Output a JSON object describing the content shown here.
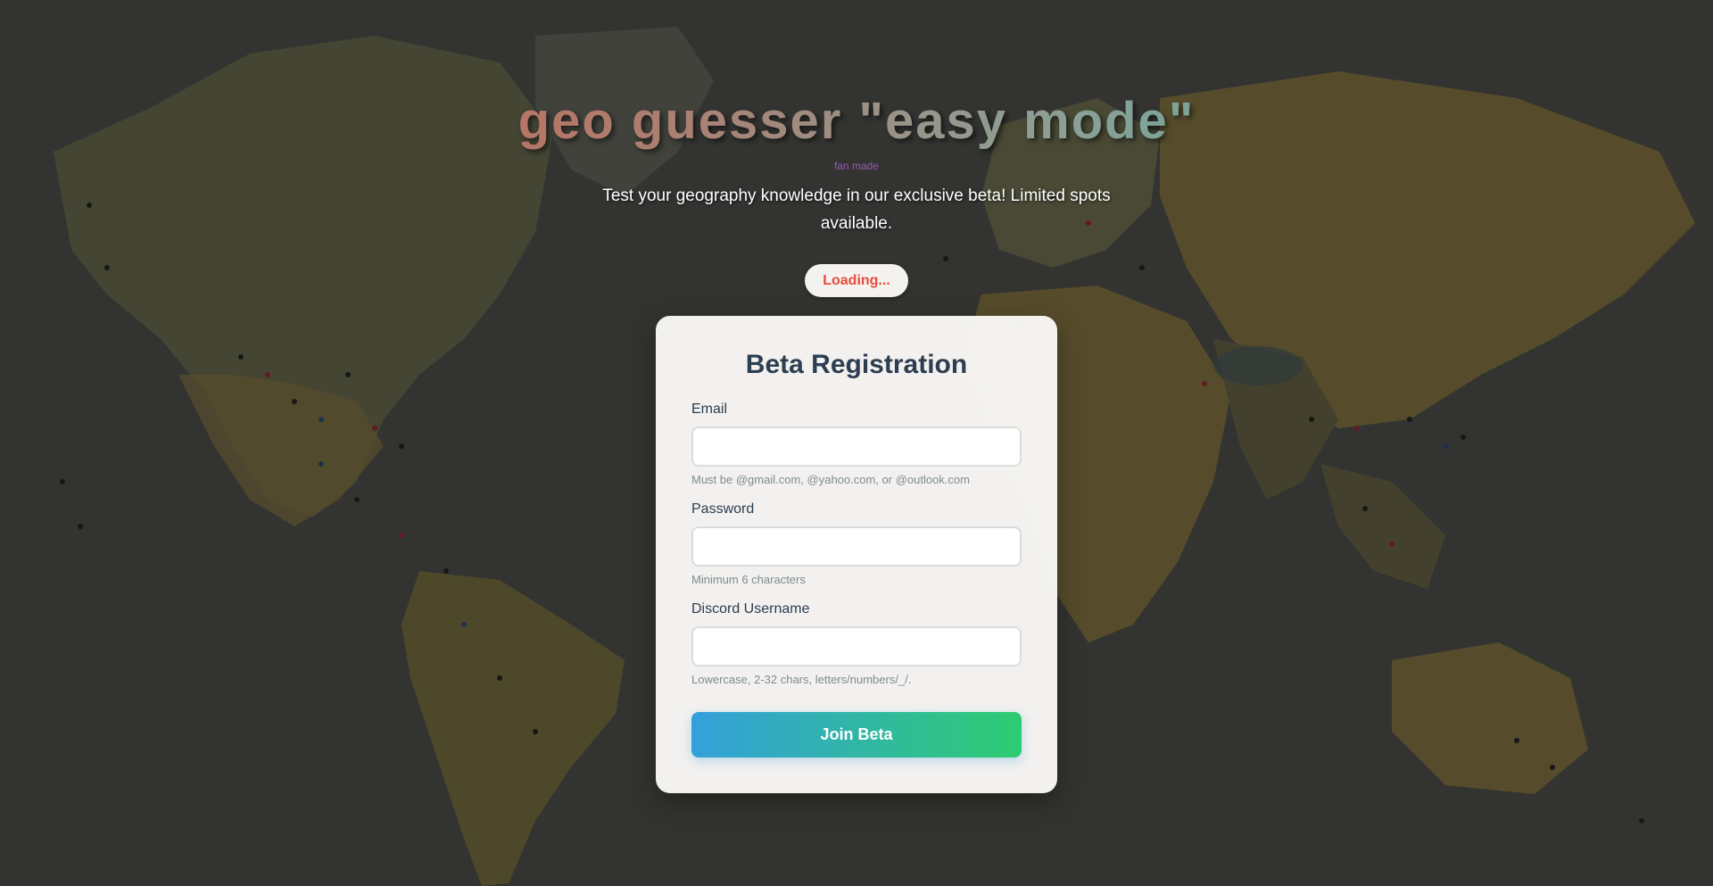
{
  "header": {
    "title": "geo guesser \"easy mode\"",
    "tagline": "fan made",
    "subtitle": "Test your geography knowledge in our exclusive beta! Limited spots available.",
    "status": "Loading..."
  },
  "form": {
    "title": "Beta Registration",
    "email": {
      "label": "Email",
      "value": "",
      "hint": "Must be @gmail.com, @yahoo.com, or @outlook.com"
    },
    "password": {
      "label": "Password",
      "value": "",
      "hint": "Minimum 6 characters"
    },
    "discord": {
      "label": "Discord Username",
      "value": "",
      "hint": "Lowercase, 2-32 chars, letters/numbers/_/."
    },
    "submit_label": "Join Beta"
  },
  "colors": {
    "title_gradient_start": "#d9534f",
    "title_gradient_end": "#3fb4a3",
    "tagline": "#9b59b6",
    "status_text": "#e74c3c",
    "card_title": "#2c3e50",
    "button_gradient_start": "#34a0db",
    "button_gradient_end": "#2ecc71"
  },
  "background": {
    "image": "world-map-with-pins"
  }
}
